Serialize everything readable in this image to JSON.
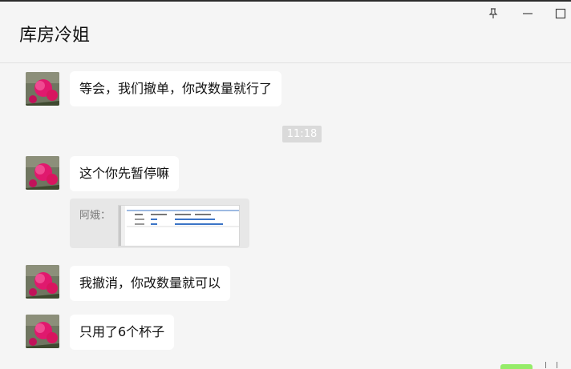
{
  "window": {
    "title": "库房冷姐",
    "controls": [
      "pin-icon",
      "minimize-icon",
      "maximize-icon"
    ]
  },
  "messages": [
    {
      "type": "text",
      "sender": "库房冷姐",
      "text": "等会，我们撤单，你改数量就行了"
    },
    {
      "type": "time",
      "text": "11:18"
    },
    {
      "type": "text",
      "sender": "库房冷姐",
      "text": "这个你先暂停嘛"
    },
    {
      "type": "quote",
      "label": "阿娥：",
      "content": "screenshot-thumbnail"
    },
    {
      "type": "text",
      "sender": "库房冷姐",
      "text": "我撤消，你改数量就可以"
    },
    {
      "type": "text",
      "sender": "库房冷姐",
      "text": "只用了6个杯子"
    }
  ],
  "colors": {
    "background": "#f5f5f5",
    "bubble": "#ffffff",
    "time_badge": "#dadada",
    "quote_bg": "#e7e7e7",
    "accent_green": "#95ec69"
  }
}
